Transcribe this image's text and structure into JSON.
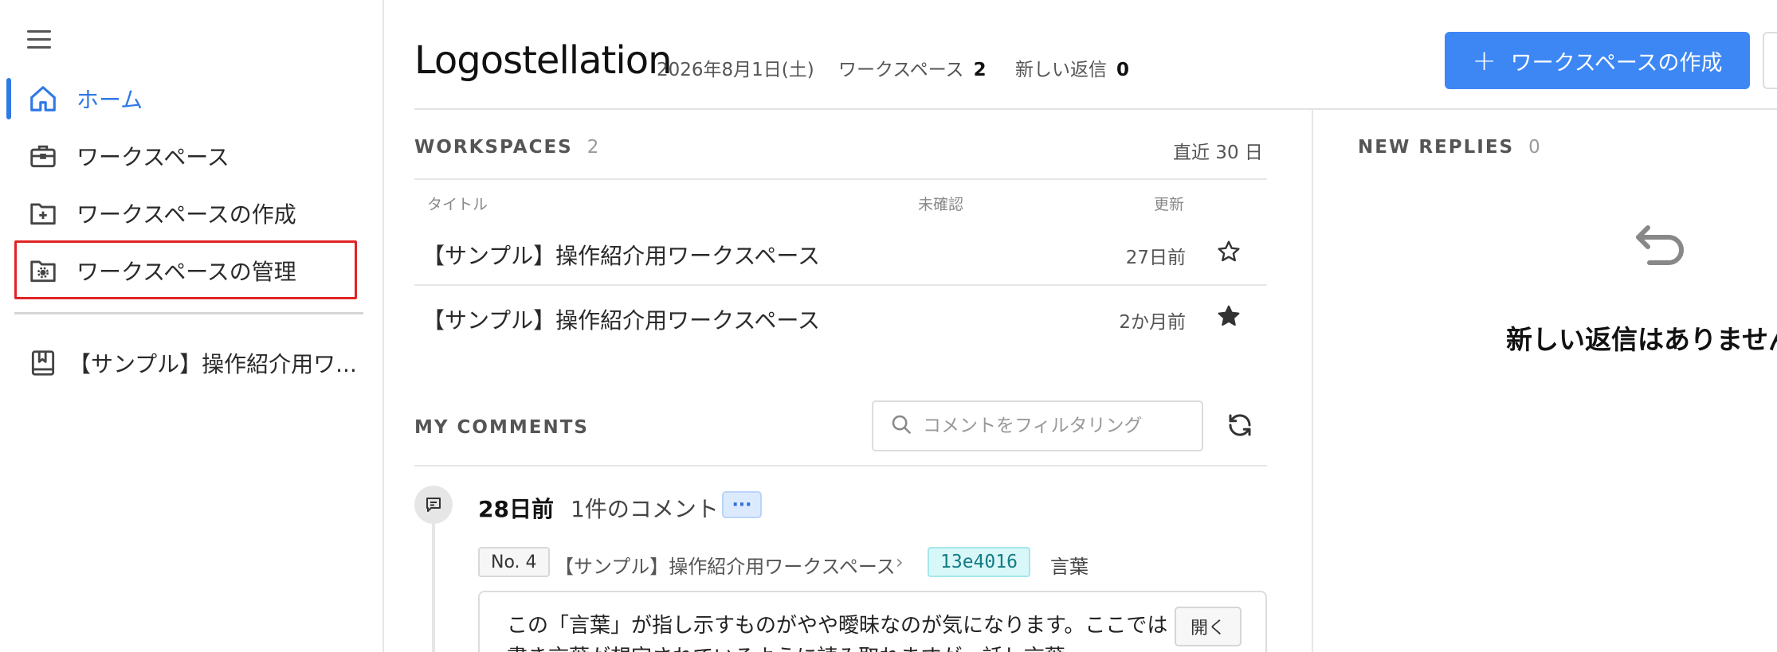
{
  "sidebar": {
    "items": [
      {
        "label": "ホーム",
        "icon": "home-icon",
        "active": true
      },
      {
        "label": "ワークスペース",
        "icon": "briefcase-icon"
      },
      {
        "label": "ワークスペースの作成",
        "icon": "folder-plus-icon"
      },
      {
        "label": "ワークスペースの管理",
        "icon": "folder-gear-icon"
      }
    ],
    "recent": [
      {
        "label": "【サンプル】操作紹介用ワ...",
        "icon": "bookmark-book-icon"
      }
    ]
  },
  "header": {
    "title": "Logostellation",
    "date": "2026年8月1日(土)",
    "workspaces_label": "ワークスペース",
    "workspaces_count": "2",
    "replies_label": "新しい返信",
    "replies_count": "0",
    "create_button": "ワークスペースの作成"
  },
  "workspaces": {
    "title": "WORKSPACES",
    "count": "2",
    "range": "直近 30 日",
    "columns": {
      "title": "タイトル",
      "unread": "未確認",
      "updated": "更新"
    },
    "rows": [
      {
        "title": "【サンプル】操作紹介用ワークスペース",
        "updated": "27日前",
        "starred": false
      },
      {
        "title": "【サンプル】操作紹介用ワークスペース",
        "updated": "2か月前",
        "starred": true
      }
    ]
  },
  "my_comments": {
    "title": "MY COMMENTS",
    "filter_placeholder": "コメントをフィルタリング",
    "entries": [
      {
        "time": "28日前",
        "count": "1件のコメント",
        "more": "···",
        "no": "No. 4",
        "workspace": "【サンプル】操作紹介用ワークスペース",
        "chevron": "›",
        "hash": "13e4016",
        "word": "言葉",
        "text": "この「言葉」が指し示すものがやや曖昧なのが気になります。ここでは書き言葉が想定されているように読み取れますが、話し言葉",
        "open_button": "開く"
      }
    ]
  },
  "new_replies": {
    "title": "NEW REPLIES",
    "count": "0",
    "empty_message": "新しい返信はありません"
  },
  "colors": {
    "accent": "#3d87f5",
    "highlight": "#e02424",
    "hash_bg": "#d8f7f9"
  }
}
